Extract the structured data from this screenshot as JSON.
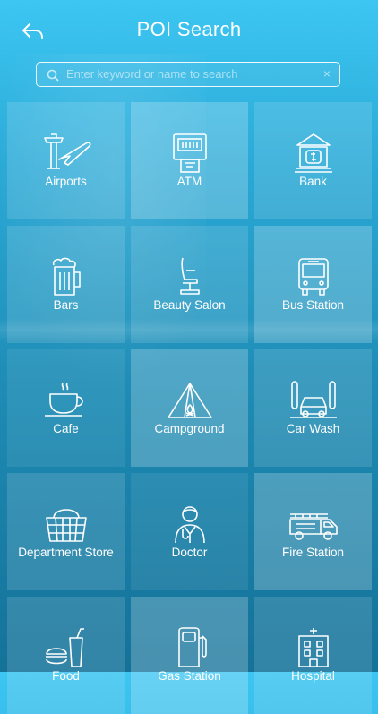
{
  "header": {
    "title": "POI Search"
  },
  "search": {
    "placeholder": "Enter keyword or name to search",
    "clear_symbol": "×"
  },
  "categories": [
    {
      "label": "Airports",
      "icon": "airport-icon"
    },
    {
      "label": "ATM",
      "icon": "atm-icon"
    },
    {
      "label": "Bank",
      "icon": "bank-icon"
    },
    {
      "label": "Bars",
      "icon": "beer-mug-icon"
    },
    {
      "label": "Beauty Salon",
      "icon": "salon-chair-icon"
    },
    {
      "label": "Bus Station",
      "icon": "bus-icon"
    },
    {
      "label": "Cafe",
      "icon": "coffee-cup-icon"
    },
    {
      "label": "Campground",
      "icon": "tent-icon"
    },
    {
      "label": "Car Wash",
      "icon": "car-wash-icon"
    },
    {
      "label": "Department Store",
      "icon": "shopping-basket-icon"
    },
    {
      "label": "Doctor",
      "icon": "doctor-icon"
    },
    {
      "label": "Fire Station",
      "icon": "fire-truck-icon"
    },
    {
      "label": "Food",
      "icon": "food-icon"
    },
    {
      "label": "Gas Station",
      "icon": "gas-pump-icon"
    },
    {
      "label": "Hospital",
      "icon": "hospital-icon"
    }
  ]
}
